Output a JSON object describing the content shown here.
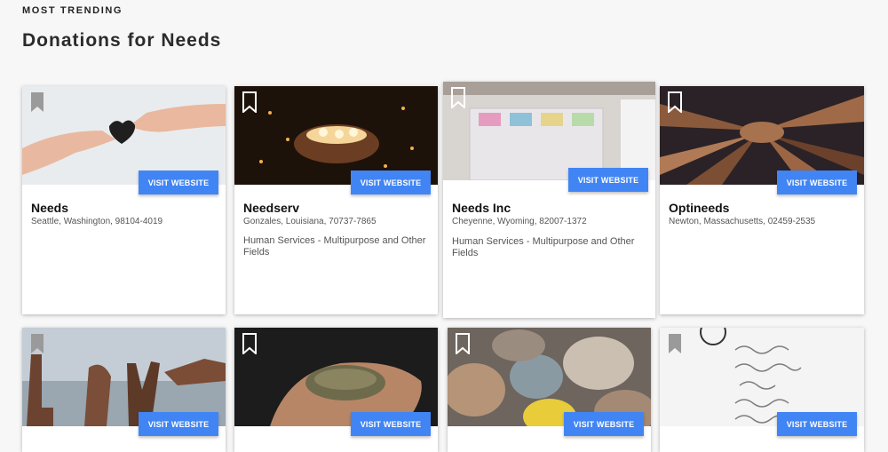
{
  "section": {
    "eyebrow": "MOST TRENDING",
    "title": "Donations for Needs"
  },
  "visit_label": "VISIT WEBSITE",
  "cards": [
    {
      "name": "Needs",
      "address": "Seattle, Washington, 98104-4019",
      "category": "",
      "image": "hands-heart-photo"
    },
    {
      "name": "Needserv",
      "address": "Gonzales, Louisiana, 70737-7865",
      "category": "Human Services - Multipurpose and Other Fields",
      "image": "candles-in-hands-photo"
    },
    {
      "name": "Needs Inc",
      "address": "Cheyenne, Wyoming, 82007-1372",
      "category": "Human Services - Multipurpose and Other Fields",
      "image": "donation-boxes-photo"
    },
    {
      "name": "Optineeds",
      "address": "Newton, Massachusetts, 02459-2535",
      "category": "",
      "image": "stacked-hands-photo"
    },
    {
      "name": "",
      "address": "",
      "category": "",
      "image": "hands-sign-language-photo"
    },
    {
      "name": "",
      "address": "",
      "category": "",
      "image": "seeds-in-hands-photo"
    },
    {
      "name": "",
      "address": "",
      "category": "",
      "image": "river-stones-photo"
    },
    {
      "name": "",
      "address": "",
      "category": "",
      "image": "handwritten-words-photo"
    }
  ],
  "colors": {
    "button": "#4185f4",
    "background": "#f7f7f7"
  }
}
